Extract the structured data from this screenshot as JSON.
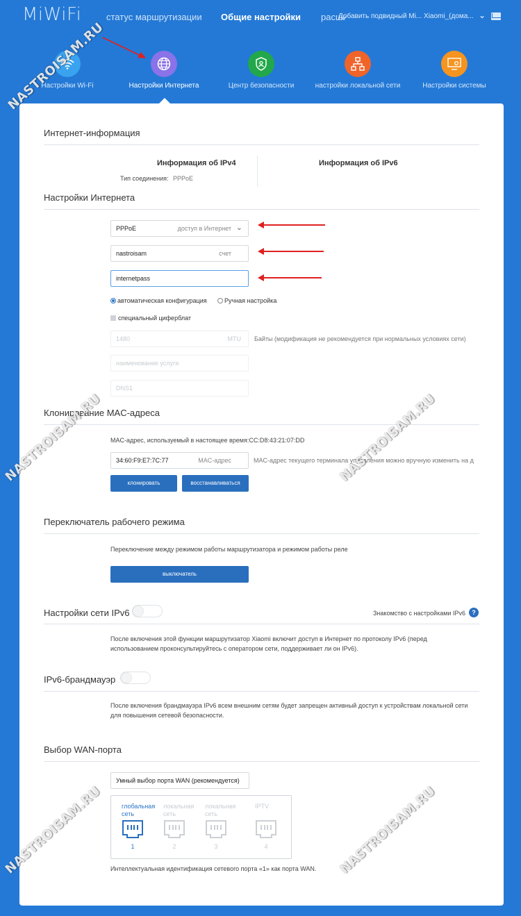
{
  "header": {
    "logo": "MiWiFi",
    "nav": [
      {
        "label": "статус маршрутизации"
      },
      {
        "label": "Общие настройки"
      },
      {
        "label": "расширенные настройки"
      }
    ],
    "user": "Добавить подвидный Mi... Xiaomi_(дома..."
  },
  "tiles": [
    {
      "label": "Настройки Wi-Fi",
      "color": "#3aa3f0",
      "icon": "wifi-icon"
    },
    {
      "label": "Настройки Интернета",
      "color": "#8a72e8",
      "icon": "globe-icon"
    },
    {
      "label": "Центр безопасности",
      "color": "#22a84a",
      "icon": "shield-icon"
    },
    {
      "label": "настройки локальной сети",
      "color": "#f0642a",
      "icon": "network-icon"
    },
    {
      "label": "Настройки системы",
      "color": "#f5941f",
      "icon": "monitor-gear-icon"
    }
  ],
  "internet_info": {
    "title": "Интернет-информация",
    "ipv4_title": "Информация об IPv4",
    "ipv6_title": "Информация об IPv6",
    "conn_type_label": "Тип соединения:",
    "conn_type_value": "PPPoE"
  },
  "internet_settings": {
    "title": "Настройки Интернета",
    "mode_value": "PPPoE",
    "mode_hint": "доступ в Интернет",
    "account_value": "nastroisam",
    "account_hint": "счет",
    "password_value": "internetpass",
    "radio_auto": "автоматическая конфигурация",
    "radio_manual": "Ручная настройка",
    "special_dial": "специальный циферблат",
    "mtu_value": "1480",
    "mtu_unit": "MTU",
    "mtu_note": "Байты (модификация не рекомендуется при нормальных условиях сети)",
    "service_placeholder": "наименование услуги",
    "dns_placeholder": "DNS1"
  },
  "mac_clone": {
    "title": "Клонирование MAC-адреса",
    "current": "MAC-адрес, используемый в настоящее время:CC:D8:43:21:07:DD",
    "mac_value": "34:60:F9:E7:7C:77",
    "mac_hint": "MAC-адрес",
    "note": "MAC-адрес текущего терминала управления можно вручную изменить на д",
    "clone_btn": "клонировать",
    "restore_btn": "восстанавливаться"
  },
  "work_mode": {
    "title": "Переключатель рабочего режима",
    "desc": "Переключение между режимом работы маршрутизатора и режимом работы реле",
    "btn": "выключатель"
  },
  "ipv6": {
    "title": "Настройки сети IPv6",
    "help_link": "Знакомство с настройками IPv6",
    "help_icon": "?",
    "desc_1": "После включения этой функции маршрутизатор Xiaomi включит доступ в Интернет по протоколу IPv6 (перед",
    "desc_2": "использованием проконсультируйтесь с оператором сети, поддерживает ли он IPv6)."
  },
  "firewall": {
    "title": "IPv6-брандмауэр",
    "desc_1": "После включения брандмауэра IPv6 всем внешним сетям будет запрещен активный доступ к устройствам локальной сети",
    "desc_2": "для повышения сетевой безопасности."
  },
  "wan": {
    "title": "Выбор WAN-порта",
    "select_value": "Умный выбор порта WAN (рекомендуется)",
    "ports": [
      {
        "l1": "глобальная",
        "l2": "сеть",
        "num": "1",
        "active": true
      },
      {
        "l1": "локальная",
        "l2": "сеть",
        "num": "2",
        "active": false
      },
      {
        "l1": "локальная",
        "l2": "сеть",
        "num": "3",
        "active": false
      },
      {
        "l1": "IPTV",
        "l2": "",
        "num": "4",
        "active": false
      }
    ],
    "note": "Интеллектуальная идентификация сетевого порта «1» как порта WAN."
  },
  "watermark": "NASTROISAM.RU"
}
